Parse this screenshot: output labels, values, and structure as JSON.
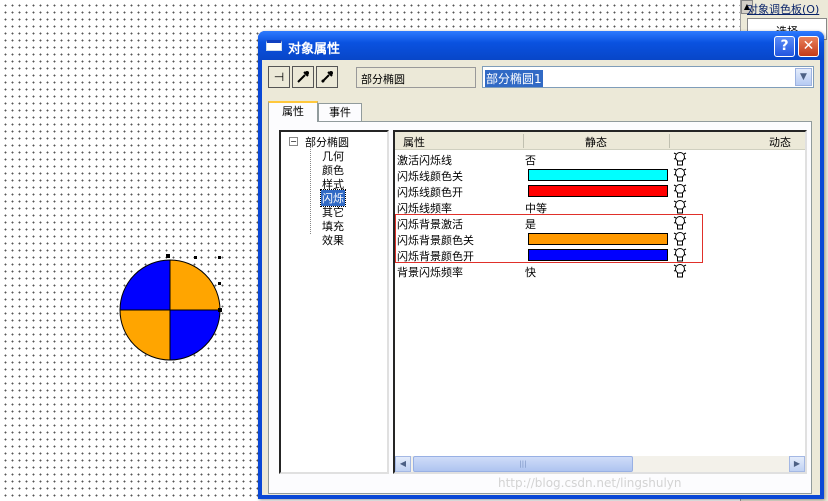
{
  "palette": {
    "title": "对象调色板(O)",
    "item": "选择"
  },
  "dialog": {
    "title": "对象属性",
    "help_button": "?",
    "close_button": "✕",
    "object_type": "部分椭圆",
    "object_name": "部分椭圆1",
    "tabs": [
      "属性",
      "事件"
    ],
    "tree": {
      "root": "部分椭圆",
      "children": [
        "几何",
        "颜色",
        "样式",
        "闪烁",
        "其它",
        "填充",
        "效果"
      ],
      "selected_index": 3
    },
    "grid": {
      "columns": [
        "属性",
        "静态",
        "动态"
      ],
      "rows": [
        {
          "name": "激活闪烁线",
          "value": "否"
        },
        {
          "name": "闪烁线颜色关",
          "color": "#00ffff"
        },
        {
          "name": "闪烁线颜色开",
          "color": "#ff0000"
        },
        {
          "name": "闪烁线频率",
          "value": "中等"
        },
        {
          "name": "闪烁背景激活",
          "value": "是"
        },
        {
          "name": "闪烁背景颜色关",
          "color": "#ff9900"
        },
        {
          "name": "闪烁背景颜色开",
          "color": "#0000ff"
        },
        {
          "name": "背景闪烁频率",
          "value": "快"
        }
      ]
    },
    "scrollbar": {
      "thumb_grip": "|||"
    }
  },
  "canvas": {
    "circle_colors": [
      "#0000ff",
      "#ffa500"
    ]
  },
  "watermark": "http://blog.csdn.net/lingshulyn"
}
